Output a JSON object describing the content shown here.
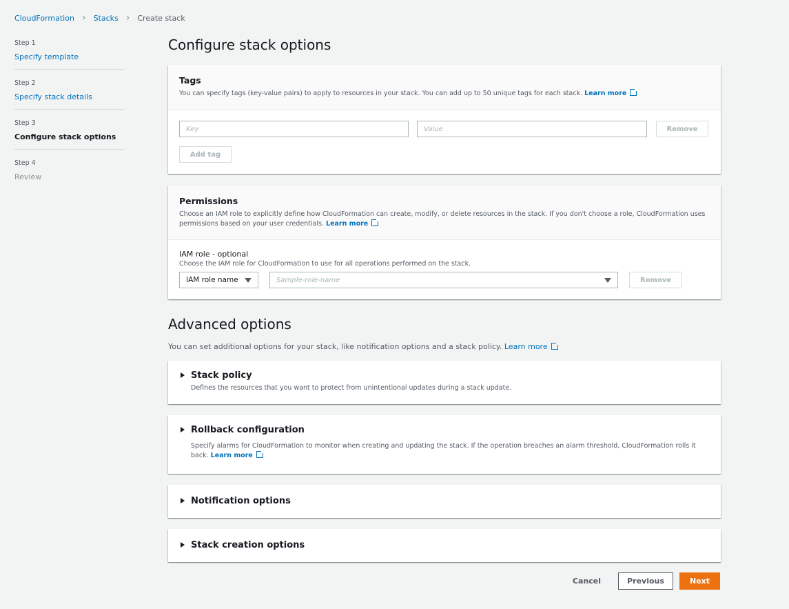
{
  "breadcrumb": {
    "items": [
      "CloudFormation",
      "Stacks"
    ],
    "current": "Create stack"
  },
  "steps": [
    {
      "num": "Step 1",
      "label": "Specify template"
    },
    {
      "num": "Step 2",
      "label": "Specify stack details"
    },
    {
      "num": "Step 3",
      "label": "Configure stack options"
    },
    {
      "num": "Step 4",
      "label": "Review"
    }
  ],
  "page_title": "Configure stack options",
  "tags": {
    "title": "Tags",
    "desc": "You can specify tags (key-value pairs) to apply to resources in your stack. You can add up to 50 unique tags for each stack.",
    "learn_more": "Learn more",
    "key_placeholder": "Key",
    "value_placeholder": "Value",
    "remove_label": "Remove",
    "add_tag_label": "Add tag"
  },
  "permissions": {
    "title": "Permissions",
    "desc": "Choose an IAM role to explicitly define how CloudFormation can create, modify, or delete resources in the stack. If you don't choose a role, CloudFormation uses permissions based on your user credentials.",
    "learn_more": "Learn more",
    "role_label": "IAM role - optional",
    "role_desc": "Choose the IAM role for CloudFormation to use for all operations performed on the stack.",
    "role_type": "IAM role name",
    "role_placeholder": "Sample-role-name",
    "remove_label": "Remove"
  },
  "advanced": {
    "title": "Advanced options",
    "desc": "You can set additional options for your stack, like notification options and a stack policy.",
    "learn_more": "Learn more",
    "sections": {
      "stack_policy": {
        "title": "Stack policy",
        "desc": "Defines the resources that you want to protect from unintentional updates during a stack update."
      },
      "rollback": {
        "title": "Rollback configuration",
        "desc": "Specify alarms for CloudFormation to monitor when creating and updating the stack. If the operation breaches an alarm threshold, CloudFormation rolls it back.",
        "learn_more_1": "Learn",
        "learn_more_2": "more"
      },
      "notification": {
        "title": "Notification options"
      },
      "creation": {
        "title": "Stack creation options"
      }
    }
  },
  "footer": {
    "cancel": "Cancel",
    "previous": "Previous",
    "next": "Next"
  }
}
